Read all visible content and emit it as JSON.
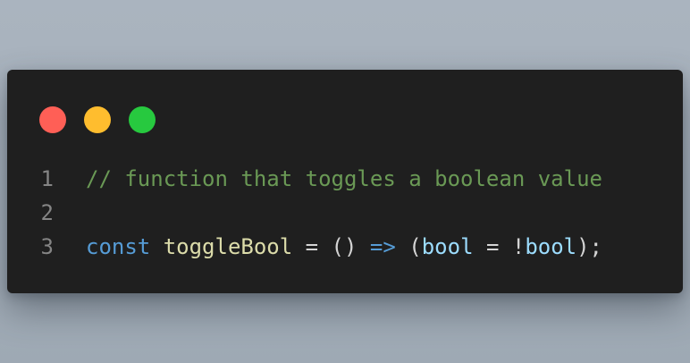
{
  "window": {
    "controls": [
      {
        "name": "close",
        "color": "#ff5f56"
      },
      {
        "name": "minimize",
        "color": "#ffbd2e"
      },
      {
        "name": "maximize",
        "color": "#27c93f"
      }
    ]
  },
  "code": {
    "lines": [
      {
        "number": "1",
        "tokens": [
          {
            "text": "// function that toggles a boolean value",
            "type": "comment"
          }
        ]
      },
      {
        "number": "2",
        "tokens": []
      },
      {
        "number": "3",
        "tokens": [
          {
            "text": "const",
            "type": "keyword"
          },
          {
            "text": " ",
            "type": "punct"
          },
          {
            "text": "toggleBool",
            "type": "func"
          },
          {
            "text": " = () ",
            "type": "punct"
          },
          {
            "text": "=>",
            "type": "keyword"
          },
          {
            "text": " (",
            "type": "punct"
          },
          {
            "text": "bool",
            "type": "var"
          },
          {
            "text": " = !",
            "type": "punct"
          },
          {
            "text": "bool",
            "type": "var"
          },
          {
            "text": ");",
            "type": "punct"
          }
        ]
      }
    ]
  }
}
